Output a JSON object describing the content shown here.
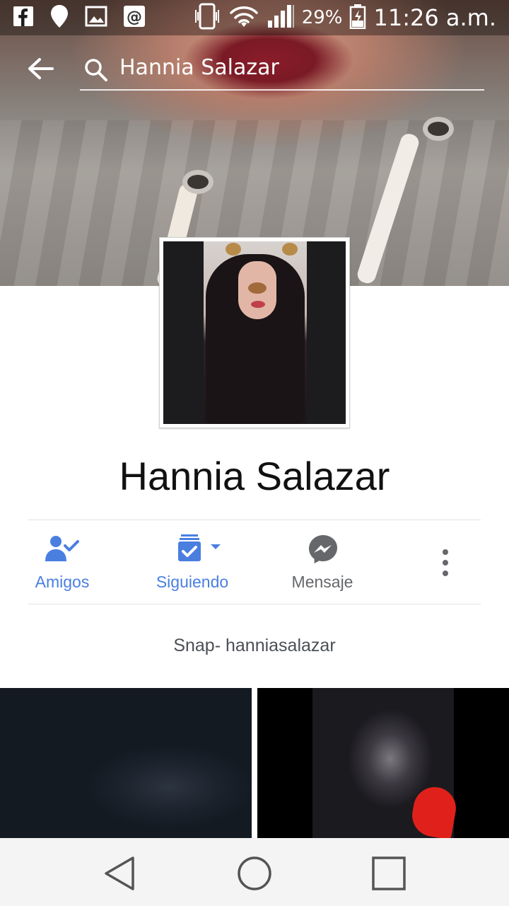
{
  "status_bar": {
    "battery_percent": "29%",
    "time": "11:26 a.m.",
    "left_icons": [
      "facebook-icon",
      "location-pin-icon",
      "image-icon",
      "at-sign-icon"
    ],
    "right_icons": [
      "vibrate-icon",
      "wifi-icon",
      "signal-icon",
      "battery-charging-icon"
    ]
  },
  "search": {
    "query": "Hannia Salazar"
  },
  "profile": {
    "name": "Hannia Salazar",
    "bio": "Snap- hanniasalazar"
  },
  "actions": {
    "friends": "Amigos",
    "following": "Siguiendo",
    "message": "Mensaje"
  },
  "colors": {
    "accent_blue": "#4a7fe0",
    "gray_text": "#65676b",
    "divider": "#e1e2e6",
    "nav_bg": "#f4f4f4"
  }
}
